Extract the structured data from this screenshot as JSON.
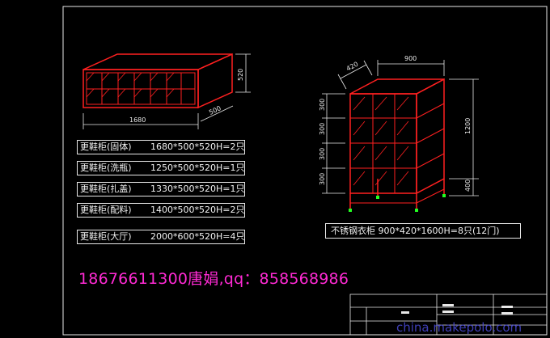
{
  "left_cabinet": {
    "dim_width": "1680",
    "dim_depth": "500",
    "dim_height": "520"
  },
  "right_cabinet": {
    "dim_width": "900",
    "dim_depth": "420",
    "dim_total_height": "1200",
    "dim_leg_height": "400",
    "dim_row_heights": [
      "300",
      "300",
      "300",
      "300"
    ]
  },
  "spec_rows": [
    {
      "name": "更鞋柜(固体)",
      "size": "1680*500*520H=2只"
    },
    {
      "name": "更鞋柜(洗瓶)",
      "size": "1250*500*520H=1只"
    },
    {
      "name": "更鞋柜(扎盖)",
      "size": "1330*500*520H=1只"
    },
    {
      "name": "更鞋柜(配料)",
      "size": "1400*500*520H=2只"
    },
    {
      "name": "更鞋柜(大厅)",
      "size": "2000*600*520H=4只"
    }
  ],
  "wardrobe_spec": "不锈钢衣柜  900*420*1600H=8只(12门)",
  "contact": "18676611300唐娟,qq：858568986",
  "watermark": "china.makepolo.com",
  "colors": {
    "background": "#000000",
    "cabinet_line": "#ff2020",
    "dimension_line": "#e8e8e8",
    "contact_text": "#ff2ad4",
    "foot_marker": "#22ff22"
  }
}
